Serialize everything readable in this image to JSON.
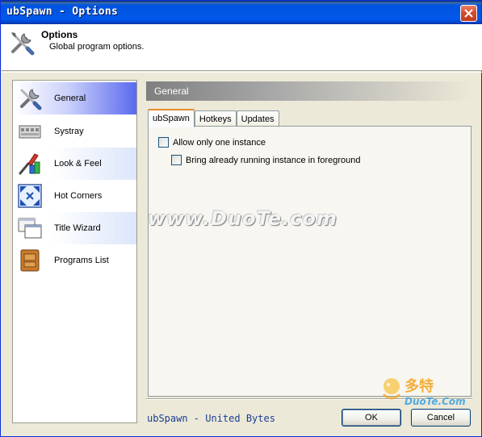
{
  "window": {
    "title": "ubSpawn - Options"
  },
  "header": {
    "title": "Options",
    "description": "Global program options."
  },
  "sidebar": {
    "items": [
      {
        "label": "General",
        "icon": "tools-icon",
        "active": true
      },
      {
        "label": "Systray",
        "icon": "systray-icon",
        "active": false
      },
      {
        "label": "Look & Feel",
        "icon": "paintbrush-icon",
        "active": false
      },
      {
        "label": "Hot Corners",
        "icon": "corners-icon",
        "active": false
      },
      {
        "label": "Title Wizard",
        "icon": "windows-icon",
        "active": false
      },
      {
        "label": "Programs List",
        "icon": "folder-icon",
        "active": false
      }
    ]
  },
  "panel": {
    "title": "General",
    "tabs": [
      {
        "label": "ubSpawn",
        "selected": true
      },
      {
        "label": "Hotkeys",
        "selected": false
      },
      {
        "label": "Updates",
        "selected": false
      }
    ],
    "options": [
      {
        "label": "Allow only one instance",
        "checked": false
      },
      {
        "label": "Bring already running instance in foreground",
        "checked": false
      }
    ]
  },
  "watermark": "www.DuoTe.com",
  "footer": {
    "brand": "ubSpawn - United Bytes",
    "ok_label": "OK",
    "cancel_label": "Cancel"
  },
  "logo": {
    "cn": "多特",
    "en": "DuoTe.Com"
  },
  "colors": {
    "titlebar": "#0054e3",
    "accent_tab": "#e68b2c",
    "sidebar_active": "#5a6aee",
    "brand_text": "#1a3e8f"
  }
}
